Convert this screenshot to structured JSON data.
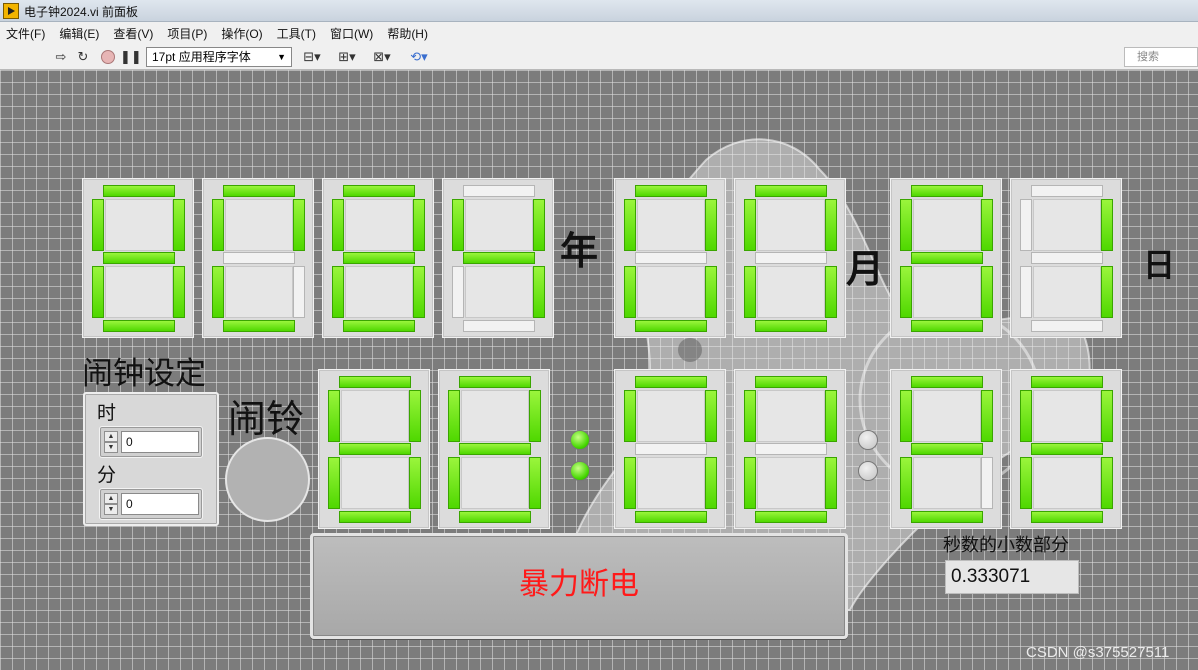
{
  "window": {
    "title": "电子钟2024.vi 前面板"
  },
  "menu": [
    "文件(F)",
    "编辑(E)",
    "查看(V)",
    "项目(P)",
    "操作(O)",
    "工具(T)",
    "窗口(W)",
    "帮助(H)"
  ],
  "toolbar": {
    "font_select": "17pt 应用程序字体",
    "search_placeholder": "搜索",
    "icons": [
      "run-arrow-icon",
      "run-continuously-icon",
      "abort-icon",
      "pause-icon",
      "align-icon",
      "distribute-icon",
      "resize-icon",
      "reorder-icon"
    ]
  },
  "date_labels": {
    "year": "年",
    "month": "月",
    "day": "日"
  },
  "date_digits": {
    "year": [
      [
        "a",
        "b",
        "c",
        "d",
        "e",
        "f",
        "g"
      ],
      [
        "a",
        "b",
        "d",
        "e",
        "f"
      ],
      [
        "a",
        "b",
        "c",
        "d",
        "e",
        "f",
        "g"
      ],
      [
        "b",
        "c",
        "f",
        "g"
      ]
    ],
    "month": [
      [
        "a",
        "b",
        "c",
        "d",
        "e",
        "f"
      ],
      [
        "a",
        "b",
        "c",
        "d",
        "e",
        "f"
      ]
    ],
    "day": [
      [
        "a",
        "b",
        "c",
        "d",
        "e",
        "f",
        "g"
      ],
      [
        "b",
        "c"
      ]
    ]
  },
  "time_digits": {
    "hour": [
      [
        "a",
        "b",
        "c",
        "d",
        "e",
        "f",
        "g"
      ],
      [
        "a",
        "b",
        "c",
        "d",
        "e",
        "f",
        "g"
      ]
    ],
    "minute": [
      [
        "a",
        "b",
        "c",
        "d",
        "e",
        "f"
      ],
      [
        "a",
        "b",
        "c",
        "d",
        "e",
        "f"
      ]
    ],
    "second": [
      [
        "a",
        "b",
        "d",
        "e",
        "f",
        "g"
      ],
      [
        "a",
        "b",
        "c",
        "d",
        "e",
        "f",
        "g"
      ]
    ]
  },
  "colon_leds": {
    "hm_on": true,
    "ms_on": false
  },
  "alarm": {
    "title": "闹钟设定",
    "hour_label": "时",
    "hour_value": "0",
    "minute_label": "分",
    "minute_value": "0"
  },
  "bell": {
    "label": "闹铃",
    "on": false
  },
  "power_button": {
    "label": "暴力断电",
    "text_color": "#ff1a1a"
  },
  "fraction": {
    "label": "秒数的小数部分",
    "value": "0.333071"
  },
  "watermark": "CSDN @s375527511",
  "colors": {
    "segment_on": "#4fd800",
    "segment_off": "#f2f2f2",
    "led_on": "#44d600"
  }
}
